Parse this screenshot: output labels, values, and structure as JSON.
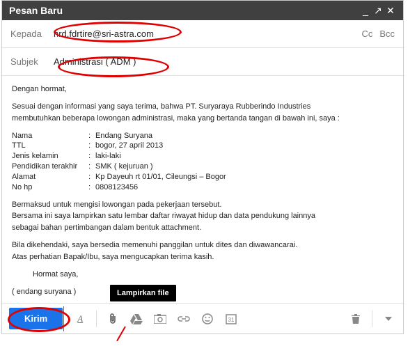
{
  "header": {
    "title": "Pesan Baru"
  },
  "fields": {
    "to_label": "Kepada",
    "to_value": "hrd.fdrtire@sri-astra.com",
    "cc": "Cc",
    "bcc": "Bcc",
    "subject_label": "Subjek",
    "subject_value": "Administrasi ( ADM )"
  },
  "body": {
    "greet": "Dengan hormat,",
    "intro1": "Sesuai dengan informasi yang saya terima, bahwa PT. Suryaraya Rubberindo Industries",
    "intro2": "membutuhkan beberapa lowongan administrasi, maka yang bertanda tangan di bawah ini, saya :",
    "rows": [
      {
        "k": "Nama",
        "v": "Endang Suryana"
      },
      {
        "k": "TTL",
        "v": "bogor, 27 april 2013"
      },
      {
        "k": "Jenis kelamin",
        "v": "laki-laki"
      },
      {
        "k": "Pendidikan terakhir",
        "v": "SMK ( kejuruan )"
      },
      {
        "k": "Alamat",
        "v": "Kp Dayeuh rt 01/01, Cileungsi – Bogor"
      },
      {
        "k": "No hp",
        "v": "0808123456"
      }
    ],
    "p1": "Bermaksud untuk mengisi lowongan pada pekerjaan tersebut.",
    "p2": "Bersama ini saya lampirkan satu lembar daftar riwayat hidup dan data pendukung lainnya",
    "p3": "sebagai bahan pertimbangan dalam bentuk attachment.",
    "p4": "Bila dikehendaki, saya bersedia memenuhi panggilan untuk dites dan diwawancarai.",
    "p5": "Atas perhatian Bapak/Ibu, saya mengucapkan terima kasih.",
    "closing": "Hormat saya,",
    "sign": "( endang suryana )"
  },
  "footer": {
    "send": "Kirim",
    "attach_tooltip": "Lampirkan file"
  }
}
